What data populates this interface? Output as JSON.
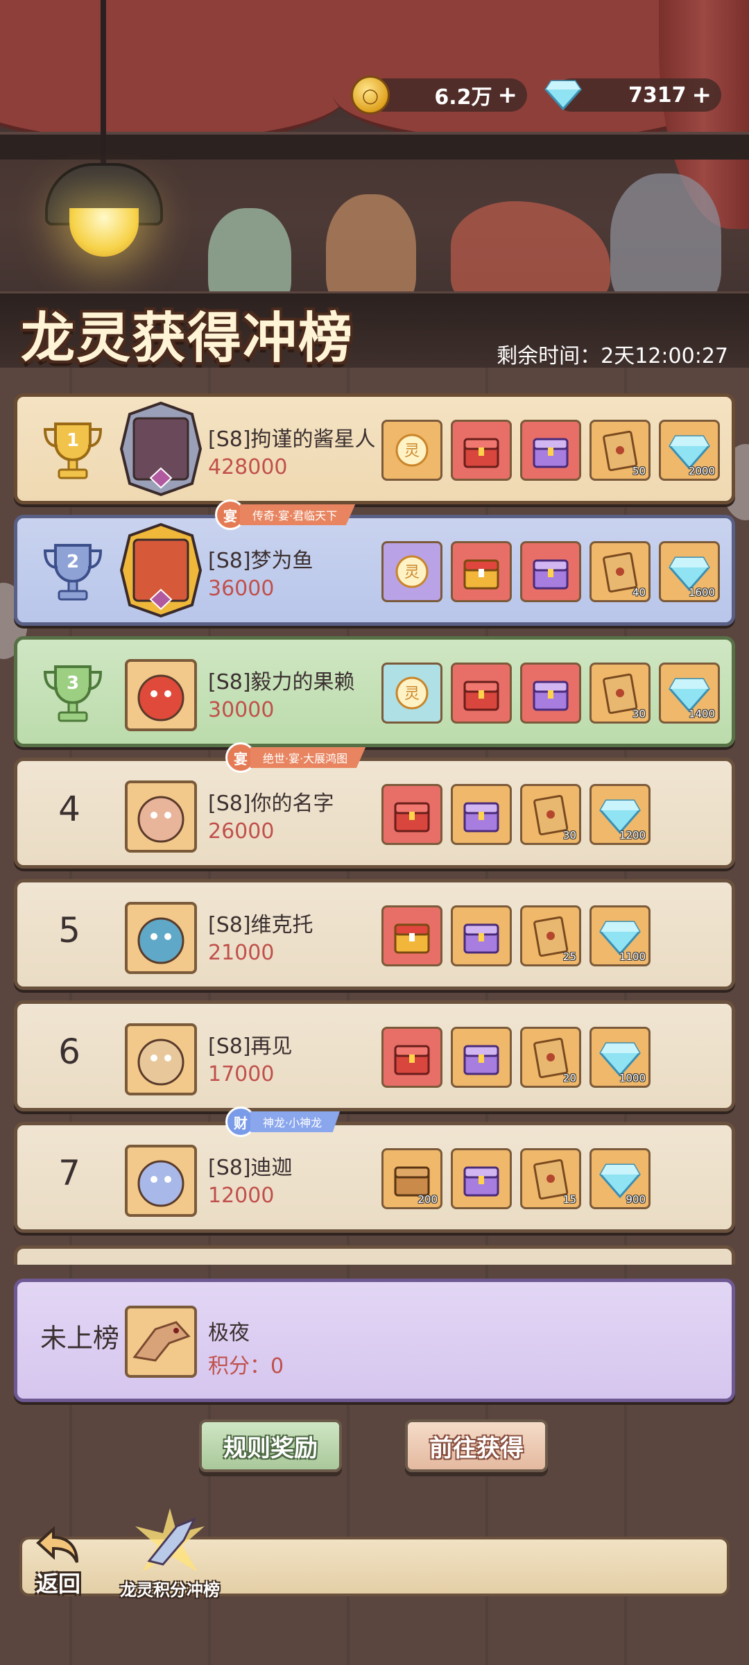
{
  "header": {
    "gold": {
      "icon": "gold-coin-icon",
      "value": "6.2万",
      "add": "+"
    },
    "diamond": {
      "icon": "diamond-icon",
      "value": "7317",
      "add": "+"
    },
    "title": "龙灵获得冲榜",
    "timer_label": "剩余时间：",
    "timer_value": "2天12:00:27"
  },
  "leaderboard": [
    {
      "rank": "1",
      "name": "[S8]拘谨的酱星人",
      "score": "428000",
      "rewards": [
        {
          "icon": "spirit-orb-icon",
          "color": "orange",
          "qty": ""
        },
        {
          "icon": "red-chest-icon",
          "color": "red",
          "qty": ""
        },
        {
          "icon": "purple-chest-icon",
          "color": "red",
          "qty": ""
        },
        {
          "icon": "scroll-ticket-icon",
          "color": "orange",
          "qty": "50"
        },
        {
          "icon": "diamond-icon",
          "color": "orange",
          "qty": "2000"
        }
      ]
    },
    {
      "rank": "2",
      "name": "[S8]梦为鱼",
      "score": "36000",
      "tag": {
        "medal": "宴",
        "text": "传奇·宴·君临天下"
      },
      "rewards": [
        {
          "icon": "spirit-orb-icon",
          "color": "purple",
          "qty": ""
        },
        {
          "icon": "gold-chest-icon",
          "color": "red",
          "qty": ""
        },
        {
          "icon": "purple-chest-icon",
          "color": "red",
          "qty": ""
        },
        {
          "icon": "scroll-ticket-icon",
          "color": "orange",
          "qty": "40"
        },
        {
          "icon": "diamond-icon",
          "color": "orange",
          "qty": "1600"
        }
      ]
    },
    {
      "rank": "3",
      "name": "[S8]毅力的果赖",
      "score": "30000",
      "rewards": [
        {
          "icon": "spirit-orb-icon",
          "color": "teal",
          "qty": ""
        },
        {
          "icon": "red-chest-icon",
          "color": "red",
          "qty": ""
        },
        {
          "icon": "purple-chest-icon",
          "color": "red",
          "qty": ""
        },
        {
          "icon": "scroll-ticket-icon",
          "color": "orange",
          "qty": "30"
        },
        {
          "icon": "diamond-icon",
          "color": "orange",
          "qty": "1400"
        }
      ]
    },
    {
      "rank": "4",
      "name": "[S8]你的名字",
      "score": "26000",
      "tag": {
        "medal": "宴",
        "text": "绝世·宴·大展鸿图"
      },
      "rewards": [
        {
          "icon": "red-chest-icon",
          "color": "red",
          "qty": ""
        },
        {
          "icon": "purple-chest-icon",
          "color": "orange",
          "qty": ""
        },
        {
          "icon": "scroll-ticket-icon",
          "color": "orange",
          "qty": "30"
        },
        {
          "icon": "diamond-icon",
          "color": "orange",
          "qty": "1200"
        }
      ]
    },
    {
      "rank": "5",
      "name": "[S8]维克托",
      "score": "21000",
      "rewards": [
        {
          "icon": "gold-chest-icon",
          "color": "red",
          "qty": ""
        },
        {
          "icon": "purple-chest-icon",
          "color": "orange",
          "qty": ""
        },
        {
          "icon": "scroll-ticket-icon",
          "color": "orange",
          "qty": "25"
        },
        {
          "icon": "diamond-icon",
          "color": "orange",
          "qty": "1100"
        }
      ]
    },
    {
      "rank": "6",
      "name": "[S8]再见",
      "score": "17000",
      "rewards": [
        {
          "icon": "red-chest-icon",
          "color": "red",
          "qty": ""
        },
        {
          "icon": "purple-chest-icon",
          "color": "orange",
          "qty": ""
        },
        {
          "icon": "scroll-ticket-icon",
          "color": "orange",
          "qty": "20"
        },
        {
          "icon": "diamond-icon",
          "color": "orange",
          "qty": "1000"
        }
      ]
    },
    {
      "rank": "7",
      "name": "[S8]迪迦",
      "score": "12000",
      "tag": {
        "medal": "财",
        "text": "神龙·小神龙"
      },
      "rewards": [
        {
          "icon": "wooden-chest-icon",
          "color": "orange",
          "qty": "200"
        },
        {
          "icon": "purple-chest-icon",
          "color": "orange",
          "qty": ""
        },
        {
          "icon": "scroll-ticket-icon",
          "color": "orange",
          "qty": "15"
        },
        {
          "icon": "diamond-icon",
          "color": "orange",
          "qty": "900"
        }
      ]
    }
  ],
  "my_entry": {
    "status": "未上榜",
    "name": "极夜",
    "score_label": "积分：",
    "score": "0"
  },
  "buttons": {
    "rules": "规则奖励",
    "obtain": "前往获得"
  },
  "bottom_nav": {
    "back": "返回",
    "active_tab": "龙灵积分冲榜"
  },
  "colors": {
    "gold_row": "#f4e2c2",
    "silver_row": "#c9d3ef",
    "bronze_row": "#cfe6c3",
    "plain_row": "#f0e5d2",
    "mine_row": "#e2d6f4",
    "score": "#c0504b"
  }
}
